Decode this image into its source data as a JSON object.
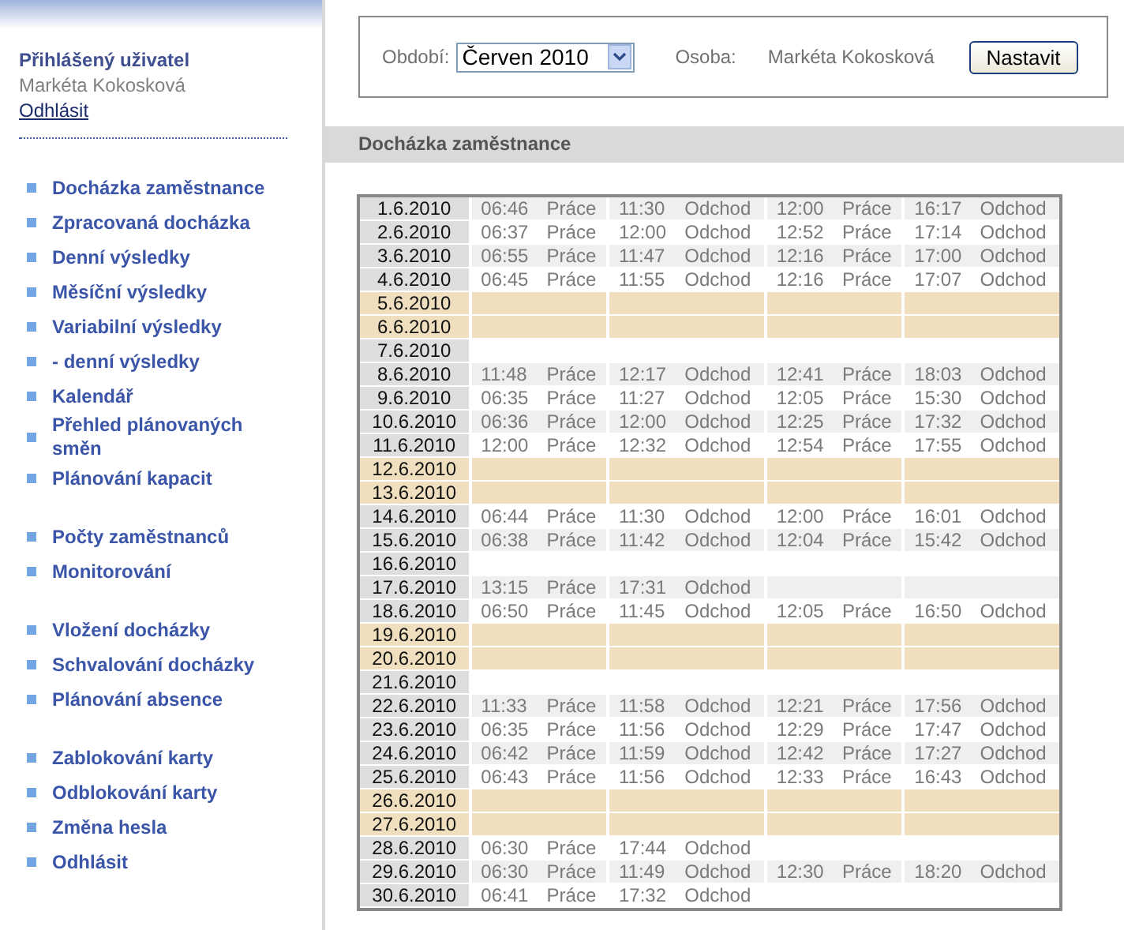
{
  "user": {
    "heading": "Přihlášený uživatel",
    "name": "Markéta Kokosková",
    "logout": "Odhlásit"
  },
  "menu_groups": [
    [
      "Docházka zaměstnance",
      "Zpracovaná docházka",
      "Denní výsledky",
      "Měsíční výsledky",
      "Variabilní výsledky",
      "- denní výsledky",
      "Kalendář",
      "Přehled plánovaných směn",
      "Plánování kapacit"
    ],
    [
      "Počty zaměstnanců",
      "Monitorování"
    ],
    [
      "Vložení docházky",
      "Schvalování docházky",
      "Plánování absence"
    ],
    [
      "Zablokování karty",
      "Odblokování karty",
      "Změna hesla",
      "Odhlásit"
    ]
  ],
  "filter": {
    "period_label": "Období:",
    "period_value": "Červen 2010",
    "person_label": "Osoba:",
    "person_value": "Markéta Kokosková",
    "button": "Nastavit"
  },
  "section_title": "Docházka zaměstnance",
  "rows": [
    {
      "date": "1.6.2010",
      "kind": "day",
      "shaded": true,
      "entries": [
        {
          "time": "06:46",
          "type": "Práce"
        },
        {
          "time": "11:30",
          "type": "Odchod"
        },
        {
          "time": "12:00",
          "type": "Práce"
        },
        {
          "time": "16:17",
          "type": "Odchod"
        }
      ]
    },
    {
      "date": "2.6.2010",
      "kind": "day",
      "shaded": false,
      "entries": [
        {
          "time": "06:37",
          "type": "Práce"
        },
        {
          "time": "12:00",
          "type": "Odchod"
        },
        {
          "time": "12:52",
          "type": "Práce"
        },
        {
          "time": "17:14",
          "type": "Odchod"
        }
      ]
    },
    {
      "date": "3.6.2010",
      "kind": "day",
      "shaded": true,
      "entries": [
        {
          "time": "06:55",
          "type": "Práce"
        },
        {
          "time": "11:47",
          "type": "Odchod"
        },
        {
          "time": "12:16",
          "type": "Práce"
        },
        {
          "time": "17:00",
          "type": "Odchod"
        }
      ]
    },
    {
      "date": "4.6.2010",
      "kind": "day",
      "shaded": false,
      "entries": [
        {
          "time": "06:45",
          "type": "Práce"
        },
        {
          "time": "11:55",
          "type": "Odchod"
        },
        {
          "time": "12:16",
          "type": "Práce"
        },
        {
          "time": "17:07",
          "type": "Odchod"
        }
      ]
    },
    {
      "date": "5.6.2010",
      "kind": "weekend",
      "entries": []
    },
    {
      "date": "6.6.2010",
      "kind": "weekend",
      "entries": []
    },
    {
      "date": "7.6.2010",
      "kind": "day",
      "shaded": false,
      "entries": []
    },
    {
      "date": "8.6.2010",
      "kind": "day",
      "shaded": true,
      "entries": [
        {
          "time": "11:48",
          "type": "Práce"
        },
        {
          "time": "12:17",
          "type": "Odchod"
        },
        {
          "time": "12:41",
          "type": "Práce"
        },
        {
          "time": "18:03",
          "type": "Odchod"
        }
      ]
    },
    {
      "date": "9.6.2010",
      "kind": "day",
      "shaded": false,
      "entries": [
        {
          "time": "06:35",
          "type": "Práce"
        },
        {
          "time": "11:27",
          "type": "Odchod"
        },
        {
          "time": "12:05",
          "type": "Práce"
        },
        {
          "time": "15:30",
          "type": "Odchod"
        }
      ]
    },
    {
      "date": "10.6.2010",
      "kind": "day",
      "shaded": true,
      "entries": [
        {
          "time": "06:36",
          "type": "Práce"
        },
        {
          "time": "12:00",
          "type": "Odchod"
        },
        {
          "time": "12:25",
          "type": "Práce"
        },
        {
          "time": "17:32",
          "type": "Odchod"
        }
      ]
    },
    {
      "date": "11.6.2010",
      "kind": "day",
      "shaded": false,
      "entries": [
        {
          "time": "12:00",
          "type": "Práce"
        },
        {
          "time": "12:32",
          "type": "Odchod"
        },
        {
          "time": "12:54",
          "type": "Práce"
        },
        {
          "time": "17:55",
          "type": "Odchod"
        }
      ]
    },
    {
      "date": "12.6.2010",
      "kind": "weekend",
      "entries": []
    },
    {
      "date": "13.6.2010",
      "kind": "weekend",
      "entries": []
    },
    {
      "date": "14.6.2010",
      "kind": "day",
      "shaded": false,
      "entries": [
        {
          "time": "06:44",
          "type": "Práce"
        },
        {
          "time": "11:30",
          "type": "Odchod"
        },
        {
          "time": "12:00",
          "type": "Práce"
        },
        {
          "time": "16:01",
          "type": "Odchod"
        }
      ]
    },
    {
      "date": "15.6.2010",
      "kind": "day",
      "shaded": true,
      "entries": [
        {
          "time": "06:38",
          "type": "Práce"
        },
        {
          "time": "11:42",
          "type": "Odchod"
        },
        {
          "time": "12:04",
          "type": "Práce"
        },
        {
          "time": "15:42",
          "type": "Odchod"
        }
      ]
    },
    {
      "date": "16.6.2010",
      "kind": "day",
      "shaded": false,
      "entries": []
    },
    {
      "date": "17.6.2010",
      "kind": "day",
      "shaded": true,
      "entries": [
        {
          "time": "13:15",
          "type": "Práce"
        },
        {
          "time": "17:31",
          "type": "Odchod"
        }
      ]
    },
    {
      "date": "18.6.2010",
      "kind": "day",
      "shaded": false,
      "entries": [
        {
          "time": "06:50",
          "type": "Práce"
        },
        {
          "time": "11:45",
          "type": "Odchod"
        },
        {
          "time": "12:05",
          "type": "Práce"
        },
        {
          "time": "16:50",
          "type": "Odchod"
        }
      ]
    },
    {
      "date": "19.6.2010",
      "kind": "weekend",
      "entries": []
    },
    {
      "date": "20.6.2010",
      "kind": "weekend",
      "entries": []
    },
    {
      "date": "21.6.2010",
      "kind": "day",
      "shaded": false,
      "entries": []
    },
    {
      "date": "22.6.2010",
      "kind": "day",
      "shaded": true,
      "entries": [
        {
          "time": "11:33",
          "type": "Práce"
        },
        {
          "time": "11:58",
          "type": "Odchod"
        },
        {
          "time": "12:21",
          "type": "Práce"
        },
        {
          "time": "17:56",
          "type": "Odchod"
        }
      ]
    },
    {
      "date": "23.6.2010",
      "kind": "day",
      "shaded": false,
      "entries": [
        {
          "time": "06:35",
          "type": "Práce"
        },
        {
          "time": "11:56",
          "type": "Odchod"
        },
        {
          "time": "12:29",
          "type": "Práce"
        },
        {
          "time": "17:47",
          "type": "Odchod"
        }
      ]
    },
    {
      "date": "24.6.2010",
      "kind": "day",
      "shaded": true,
      "entries": [
        {
          "time": "06:42",
          "type": "Práce"
        },
        {
          "time": "11:59",
          "type": "Odchod"
        },
        {
          "time": "12:42",
          "type": "Práce"
        },
        {
          "time": "17:27",
          "type": "Odchod"
        }
      ]
    },
    {
      "date": "25.6.2010",
      "kind": "day",
      "shaded": false,
      "entries": [
        {
          "time": "06:43",
          "type": "Práce"
        },
        {
          "time": "11:56",
          "type": "Odchod"
        },
        {
          "time": "12:33",
          "type": "Práce"
        },
        {
          "time": "16:43",
          "type": "Odchod"
        }
      ]
    },
    {
      "date": "26.6.2010",
      "kind": "weekend",
      "entries": []
    },
    {
      "date": "27.6.2010",
      "kind": "weekend",
      "entries": []
    },
    {
      "date": "28.6.2010",
      "kind": "day",
      "shaded": false,
      "entries": [
        {
          "time": "06:30",
          "type": "Práce"
        },
        {
          "time": "17:44",
          "type": "Odchod"
        }
      ]
    },
    {
      "date": "29.6.2010",
      "kind": "day",
      "shaded": true,
      "entries": [
        {
          "time": "06:30",
          "type": "Práce"
        },
        {
          "time": "11:49",
          "type": "Odchod"
        },
        {
          "time": "12:30",
          "type": "Práce"
        },
        {
          "time": "18:20",
          "type": "Odchod"
        }
      ]
    },
    {
      "date": "30.6.2010",
      "kind": "day",
      "shaded": false,
      "entries": [
        {
          "time": "06:41",
          "type": "Práce"
        },
        {
          "time": "17:32",
          "type": "Odchod"
        }
      ]
    }
  ]
}
